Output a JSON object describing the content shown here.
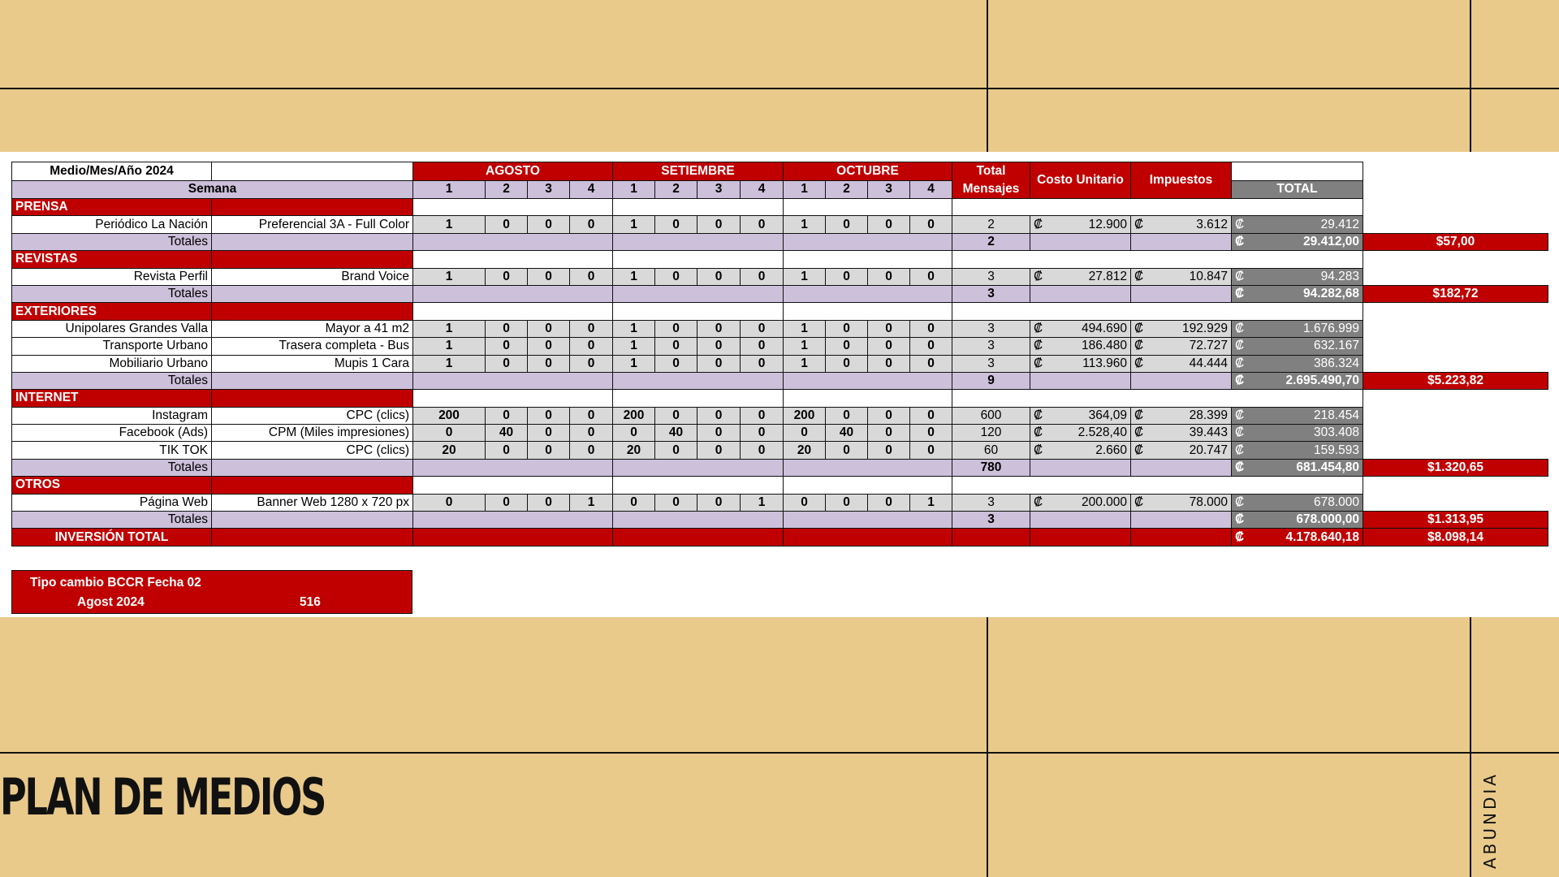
{
  "header": {
    "medio": "Medio/Mes/Año 2024",
    "semana": "Semana",
    "months": [
      "AGOSTO",
      "SETIEMBRE",
      "OCTUBRE"
    ],
    "weeks": [
      "1",
      "2",
      "3",
      "4"
    ],
    "total_mensajes": "Total Mensajes",
    "costo_unitario": "Costo Unitario",
    "impuestos": "Impuestos",
    "total": "TOTAL"
  },
  "currency": "₡",
  "totales_label": "Totales",
  "sections": [
    {
      "name": "PRENSA",
      "rows": [
        {
          "medio": "Periódico La Nación",
          "formato": "Preferencial 3A - Full Color",
          "weeks": [
            "1",
            "0",
            "0",
            "0",
            "1",
            "0",
            "0",
            "0",
            "1",
            "0",
            "0",
            "0"
          ],
          "total": "2",
          "costo": "12.900",
          "impuestos": "3.612",
          "subtotal": "29.412"
        }
      ],
      "totales": {
        "mensajes": "2",
        "crc": "29.412,00",
        "usd": "$57,00"
      }
    },
    {
      "name": "REVISTAS",
      "rows": [
        {
          "medio": "Revista Perfil",
          "formato": "Brand Voice",
          "weeks": [
            "1",
            "0",
            "0",
            "0",
            "1",
            "0",
            "0",
            "0",
            "1",
            "0",
            "0",
            "0"
          ],
          "total": "3",
          "costo": "27.812",
          "impuestos": "10.847",
          "subtotal": "94.283"
        }
      ],
      "totales": {
        "mensajes": "3",
        "crc": "94.282,68",
        "usd": "$182,72"
      }
    },
    {
      "name": "EXTERIORES",
      "rows": [
        {
          "medio": "Unipolares Grandes Valla",
          "formato": "Mayor a 41 m2",
          "weeks": [
            "1",
            "0",
            "0",
            "0",
            "1",
            "0",
            "0",
            "0",
            "1",
            "0",
            "0",
            "0"
          ],
          "total": "3",
          "costo": "494.690",
          "impuestos": "192.929",
          "subtotal": "1.676.999"
        },
        {
          "medio": "Transporte Urbano",
          "formato": "Trasera completa - Bus",
          "weeks": [
            "1",
            "0",
            "0",
            "0",
            "1",
            "0",
            "0",
            "0",
            "1",
            "0",
            "0",
            "0"
          ],
          "total": "3",
          "costo": "186.480",
          "impuestos": "72.727",
          "subtotal": "632.167"
        },
        {
          "medio": "Mobiliario Urbano",
          "formato": "Mupis 1 Cara",
          "weeks": [
            "1",
            "0",
            "0",
            "0",
            "1",
            "0",
            "0",
            "0",
            "1",
            "0",
            "0",
            "0"
          ],
          "total": "3",
          "costo": "113.960",
          "impuestos": "44.444",
          "subtotal": "386.324"
        }
      ],
      "totales": {
        "mensajes": "9",
        "crc": "2.695.490,70",
        "usd": "$5.223,82"
      }
    },
    {
      "name": "INTERNET",
      "rows": [
        {
          "medio": "Instagram",
          "formato": "CPC (clics)",
          "weeks": [
            "200",
            "0",
            "0",
            "0",
            "200",
            "0",
            "0",
            "0",
            "200",
            "0",
            "0",
            "0"
          ],
          "total": "600",
          "costo": "364,09",
          "impuestos": "28.399",
          "subtotal": "218.454"
        },
        {
          "medio": "Facebook (Ads)",
          "formato": "CPM (Miles impresiones)",
          "weeks": [
            "0",
            "40",
            "0",
            "0",
            "0",
            "40",
            "0",
            "0",
            "0",
            "40",
            "0",
            "0"
          ],
          "total": "120",
          "costo": "2.528,40",
          "impuestos": "39.443",
          "subtotal": "303.408"
        },
        {
          "medio": "TIK TOK",
          "formato": "CPC (clics)",
          "weeks": [
            "20",
            "0",
            "0",
            "0",
            "20",
            "0",
            "0",
            "0",
            "20",
            "0",
            "0",
            "0"
          ],
          "total": "60",
          "costo": "2.660",
          "impuestos": "20.747",
          "subtotal": "159.593"
        }
      ],
      "totales": {
        "mensajes": "780",
        "crc": "681.454,80",
        "usd": "$1.320,65"
      }
    },
    {
      "name": "OTROS",
      "rows": [
        {
          "medio": "Página Web",
          "formato": "Banner Web 1280 x 720 px",
          "weeks": [
            "0",
            "0",
            "0",
            "1",
            "0",
            "0",
            "0",
            "1",
            "0",
            "0",
            "0",
            "1"
          ],
          "total": "3",
          "costo": "200.000",
          "impuestos": "78.000",
          "subtotal": "678.000"
        }
      ],
      "totales": {
        "mensajes": "3",
        "crc": "678.000,00",
        "usd": "$1.313,95"
      }
    }
  ],
  "inversion_total": {
    "label": "INVERSIÓN TOTAL",
    "crc": "4.178.640,18",
    "usd": "$8.098,14"
  },
  "tipo_cambio": {
    "line1": "Tipo cambio BCCR Fecha 02",
    "line2": "Agost 2024",
    "value": "516"
  },
  "page_title": "PLAN DE MEDIOS",
  "brand": "ABUNDIA",
  "colors": {
    "background": "#e9ca8b",
    "accent_red": "#c00000",
    "lavender": "#ccc0da",
    "grey": "#d9d9d9",
    "dark_grey": "#808080"
  }
}
